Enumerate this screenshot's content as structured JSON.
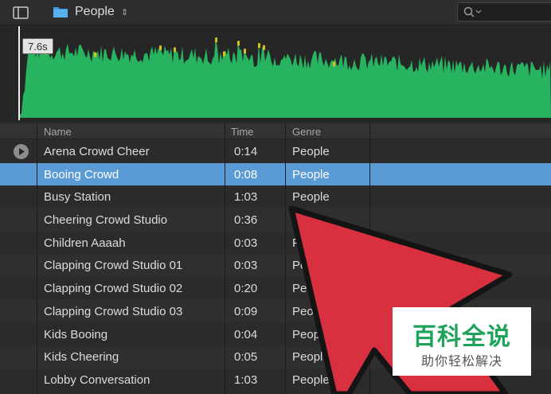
{
  "toolbar": {
    "sidebar_toggle_icon": "sidebar-icon",
    "location": {
      "icon": "folder-icon",
      "title": "People",
      "chevron": "⇕"
    },
    "search": {
      "icon": "search-icon",
      "value": ""
    }
  },
  "preview": {
    "duration": "7.6s",
    "colors": {
      "wave": "#27b35f",
      "peak": "#d4c21a"
    }
  },
  "table": {
    "columns": [
      "Name",
      "Time",
      "Genre"
    ],
    "selected_index": 1,
    "playing_index": 0,
    "rows": [
      {
        "name": "Arena Crowd Cheer",
        "time": "0:14",
        "genre": "People"
      },
      {
        "name": "Booing Crowd",
        "time": "0:08",
        "genre": "People"
      },
      {
        "name": "Busy Station",
        "time": "1:03",
        "genre": "People"
      },
      {
        "name": "Cheering Crowd Studio",
        "time": "0:36",
        "genre": "People"
      },
      {
        "name": "Children Aaaah",
        "time": "0:03",
        "genre": "People"
      },
      {
        "name": "Clapping Crowd Studio 01",
        "time": "0:03",
        "genre": "People"
      },
      {
        "name": "Clapping Crowd Studio 02",
        "time": "0:20",
        "genre": "People"
      },
      {
        "name": "Clapping Crowd Studio 03",
        "time": "0:09",
        "genre": "People"
      },
      {
        "name": "Kids Booing",
        "time": "0:04",
        "genre": "People"
      },
      {
        "name": "Kids Cheering",
        "time": "0:05",
        "genre": "People"
      },
      {
        "name": "Lobby Conversation",
        "time": "1:03",
        "genre": "People"
      }
    ],
    "colors": {
      "selected": "#5b9bd5"
    }
  },
  "overlay": {
    "arrow_color": "#d8303f"
  },
  "watermark": {
    "title": "百科全说",
    "subtitle": "助你轻松解决"
  }
}
